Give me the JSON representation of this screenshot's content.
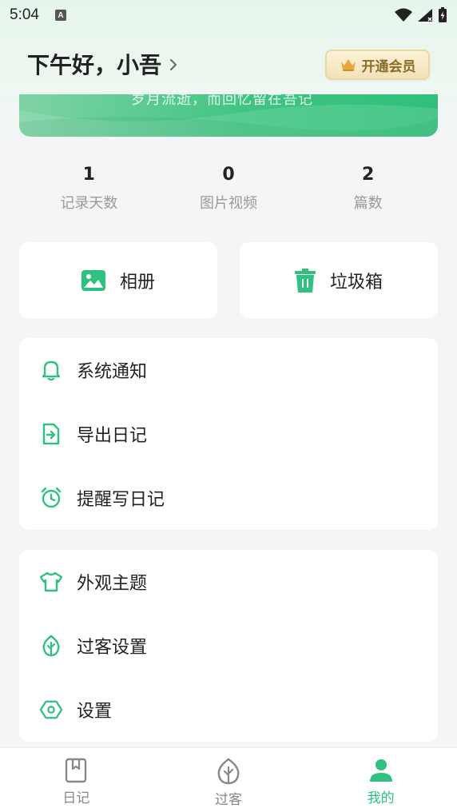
{
  "status_bar": {
    "time": "5:04",
    "notification_letter": "A"
  },
  "header": {
    "greeting": "下午好，小吾"
  },
  "vip": {
    "label": "开通会员"
  },
  "banner": {
    "text": "岁月流逝，而回忆留在吾记"
  },
  "stats": [
    {
      "value": "1",
      "label": "记录天数"
    },
    {
      "value": "0",
      "label": "图片视频"
    },
    {
      "value": "2",
      "label": "篇数"
    }
  ],
  "quick_cards": [
    {
      "label": "相册",
      "icon": "image-icon"
    },
    {
      "label": "垃圾箱",
      "icon": "trash-icon"
    }
  ],
  "menu_group_1": [
    {
      "label": "系统通知",
      "icon": "bell-icon"
    },
    {
      "label": "导出日记",
      "icon": "export-file-icon"
    },
    {
      "label": "提醒写日记",
      "icon": "alarm-clock-icon"
    }
  ],
  "menu_group_2": [
    {
      "label": "外观主题",
      "icon": "tshirt-icon"
    },
    {
      "label": "过客设置",
      "icon": "leaf-icon"
    },
    {
      "label": "设置",
      "icon": "settings-hex-icon"
    }
  ],
  "tabs": [
    {
      "label": "日记",
      "icon": "diary-book-icon",
      "active": false
    },
    {
      "label": "过客",
      "icon": "leaf-icon",
      "active": false
    },
    {
      "label": "我的",
      "icon": "person-icon",
      "active": true
    }
  ],
  "colors": {
    "accent": "#2ec27e",
    "background": "#f4f5f7",
    "vip_text": "#8c6a2a"
  }
}
